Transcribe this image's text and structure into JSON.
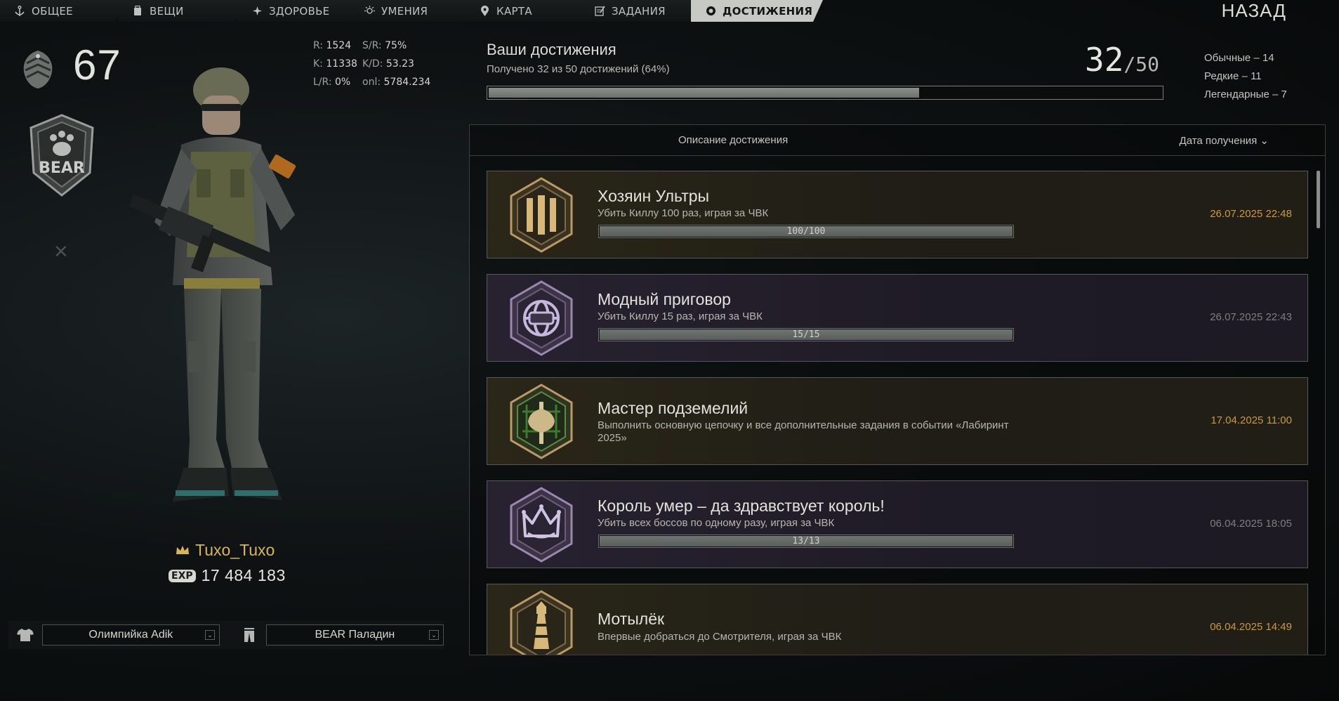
{
  "tabs": [
    {
      "label": "ОБЩЕЕ",
      "icon": "anchor-icon"
    },
    {
      "label": "ВЕЩИ",
      "icon": "inventory-icon"
    },
    {
      "label": "ЗДОРОВЬЕ",
      "icon": "health-icon"
    },
    {
      "label": "УМЕНИЯ",
      "icon": "skills-icon"
    },
    {
      "label": "КАРТА",
      "icon": "map-pin-icon"
    },
    {
      "label": "ЗАДАНИЯ",
      "icon": "tasks-icon"
    },
    {
      "label": "ДОСТИЖЕНИЯ",
      "icon": "achievements-icon"
    }
  ],
  "active_tab": "ДОСТИЖЕНИЯ",
  "back_label": "НАЗАД",
  "profile": {
    "level": "67",
    "stats": {
      "r_label": "R:",
      "r_value": "1524",
      "sr_label": "S/R:",
      "sr_value": "75%",
      "k_label": "K:",
      "k_value": "11338",
      "kd_label": "K/D:",
      "kd_value": "53.23",
      "lr_label": "L/R:",
      "lr_value": "0%",
      "onl_label": "onl:",
      "onl_value": "5784.234"
    },
    "faction": "BEAR",
    "nickname": "Tuxo_Tuxo",
    "exp_label": "EXP",
    "exp_value": "17 484 183",
    "clothing_top": "Олимпийка Adik",
    "clothing_bottom": "BEAR Паладин"
  },
  "summary": {
    "title": "Ваши достижения",
    "subtitle": "Получено 32 из 50 достижений (64%)",
    "progress_fraction": 0.64,
    "count": "32",
    "total": "/50",
    "rarity": {
      "common": "Обычные – 14",
      "rare": "Редкие – 11",
      "legendary": "Легендарные – 7"
    }
  },
  "list_header": {
    "description": "Описание достижения",
    "date": "Дата получения"
  },
  "achievements": [
    {
      "name": "Хозяин Ультры",
      "description": "Убить Киллу 100 раз, играя за ЧВК",
      "progress_text": "100/100",
      "progress_fraction": 1.0,
      "date": "26.07.2025 22:48",
      "rarity": "legendary",
      "icon": "ultra-stripes-icon"
    },
    {
      "name": "Модный приговор",
      "description": "Убить Киллу 15 раз, играя за ЧВК",
      "progress_text": "15/15",
      "progress_fraction": 1.0,
      "date": "26.07.2025 22:43",
      "rarity": "rare",
      "icon": "helmet-globe-icon"
    },
    {
      "name": "Мастер подземелий",
      "description": "Выполнить основную цепочку и все дополнительные задания в событии «Лабиринт 2025»",
      "date": "17.04.2025 11:00",
      "rarity": "legendary",
      "icon": "labyrinth-axe-icon"
    },
    {
      "name": "Король умер – да здравствует король!",
      "description": "Убить всех боссов по одному разу, играя за ЧВК",
      "progress_text": "13/13",
      "progress_fraction": 1.0,
      "date": "06.04.2025 18:05",
      "rarity": "rare",
      "icon": "crown-icon"
    },
    {
      "name": "Мотылёк",
      "description": "Впервые добраться до Смотрителя, играя за ЧВК",
      "date": "06.04.2025 14:49",
      "rarity": "legendary",
      "icon": "lighthouse-icon"
    }
  ]
}
